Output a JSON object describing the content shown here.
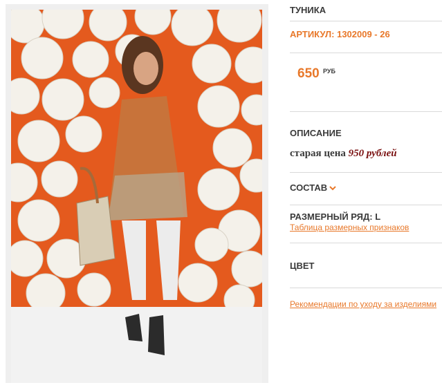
{
  "product": {
    "title": "ТУНИКА",
    "sku": "АРТИКУЛ: 1302009 - 26",
    "price": "650",
    "currency": "РУБ",
    "description_heading": "ОПИСАНИЕ",
    "old_price_label": "старая цена",
    "old_price_value": "950 рублей",
    "composition_heading": "СОСТАВ",
    "size_range": "РАЗМЕРНЫЙ РЯД: L",
    "size_table_link": "Таблица размерных признаков",
    "color_heading": "ЦВЕТ",
    "care_link": "Рекомендации по уходу за изделиями"
  },
  "colors": {
    "accent": "#e8782a",
    "old_price": "#7a1010",
    "text": "#3a3a3a",
    "photo_bg": "#e45a1e"
  },
  "icons": {
    "composition_toggle": "chevron-down-icon"
  }
}
